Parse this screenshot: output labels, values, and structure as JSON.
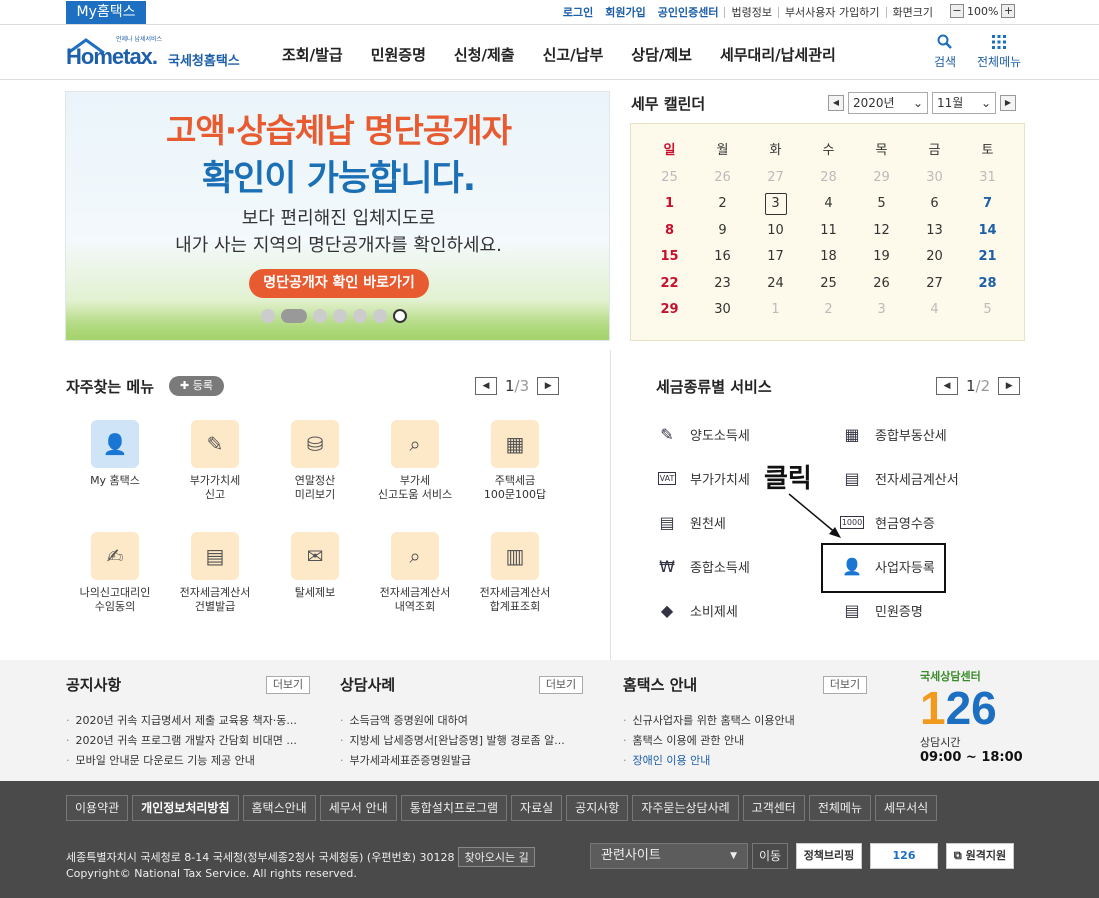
{
  "topbar": {
    "myhometax": "My홈택스",
    "links": [
      "로그인",
      "회원가입",
      "공인인증센터",
      "법령정보",
      "부서사용자 가입하기",
      "화면크기"
    ],
    "zoom": "100%",
    "zoom_minus": "−",
    "zoom_plus": "+"
  },
  "header": {
    "logo_small": "언제나 납세서비스",
    "logo_main": "Hometax.",
    "logo_kr": "국세청홈택스",
    "nav": [
      "조회/발급",
      "민원증명",
      "신청/제출",
      "신고/납부",
      "상담/제보",
      "세무대리/납세관리"
    ],
    "search_label": "검색",
    "allmenu_label": "전체메뉴"
  },
  "banner": {
    "line1": "고액·상습체납 명단공개자",
    "line2": "확인이 가능합니다.",
    "line3": "보다 편리해진 입체지도로",
    "line4": "내가 사는 지역의 명단공개자를 확인하세요.",
    "button": "명단공개자 확인 바로가기"
  },
  "calendar": {
    "title": "세무 캘린더",
    "year": "2020년",
    "month": "11월",
    "weekdays": [
      "일",
      "월",
      "화",
      "수",
      "목",
      "금",
      "토"
    ],
    "weeks": [
      [
        "25",
        "26",
        "27",
        "28",
        "29",
        "30",
        "31"
      ],
      [
        "1",
        "2",
        "3",
        "4",
        "5",
        "6",
        "7"
      ],
      [
        "8",
        "9",
        "10",
        "11",
        "12",
        "13",
        "14"
      ],
      [
        "15",
        "16",
        "17",
        "18",
        "19",
        "20",
        "21"
      ],
      [
        "22",
        "23",
        "24",
        "25",
        "26",
        "27",
        "28"
      ],
      [
        "29",
        "30",
        "1",
        "2",
        "3",
        "4",
        "5"
      ]
    ]
  },
  "favorites": {
    "title": "자주찾는 메뉴",
    "add": "등록",
    "page": "1",
    "total": "/3",
    "items": [
      {
        "label": "My 홈택스"
      },
      {
        "label": "부가가치세\n신고"
      },
      {
        "label": "연말정산\n미리보기"
      },
      {
        "label": "부가세\n신고도움 서비스"
      },
      {
        "label": "주택세금\n100문100답"
      },
      {
        "label": "나의신고대리인\n수임동의"
      },
      {
        "label": "전자세금계산서\n건별발급"
      },
      {
        "label": "탈세제보"
      },
      {
        "label": "전자세금계산서\n내역조회"
      },
      {
        "label": "전자세금계산서\n합계표조회"
      }
    ]
  },
  "taxservices": {
    "title": "세금종류별 서비스",
    "page": "1",
    "total": "/2",
    "left": [
      "양도소득세",
      "부가가치세",
      "원천세",
      "종합소득세",
      "소비제세"
    ],
    "right": [
      "종합부동산세",
      "전자세금계산서",
      "현금영수증",
      "사업자등록",
      "민원증명"
    ],
    "annotation": "클릭"
  },
  "notices": {
    "notice": {
      "title": "공지사항",
      "more": "더보기",
      "items": [
        "2020년 귀속 지급명세서 제출 교육용 책자·동...",
        "2020년 귀속 프로그램 개발자 간담회 비대면 ...",
        "모바일 안내문 다운로드 기능 제공 안내"
      ]
    },
    "cases": {
      "title": "상담사례",
      "more": "더보기",
      "items": [
        "소득금액 증명원에 대하여",
        "지방세 납세증명서[완납증명] 발행 경로좀 알...",
        "부가세과세표준증명원발급"
      ]
    },
    "guide": {
      "title": "홈택스 안내",
      "more": "더보기",
      "items": [
        "신규사업자를 위한 홈택스 이용안내",
        "홈택스 이용에 관한 안내",
        "장애인 이용 안내"
      ]
    }
  },
  "center126": {
    "title": "국세상담센터",
    "number_a": "1",
    "number_b": "26",
    "hours_label": "상담시간",
    "hours": "09:00 ~ 18:00"
  },
  "footer": {
    "links": [
      "이용약관",
      "개인정보처리방침",
      "홈택스안내",
      "세무서 안내",
      "통합설치프로그램",
      "자료실",
      "공지사항",
      "자주묻는상담사례",
      "고객센터",
      "전체메뉴",
      "세무서식"
    ],
    "address": "세종특별자치시 국세청로 8-14 국세청(정부세종2청사 국세청동) (우편번호) 30128",
    "find": "찾아오시는 길",
    "copyright": "Copyright© National Tax Service. All rights reserved.",
    "related": "관련사이트",
    "go": "이동",
    "policy": "정책브리핑",
    "center": "126",
    "remote": "원격지원"
  }
}
